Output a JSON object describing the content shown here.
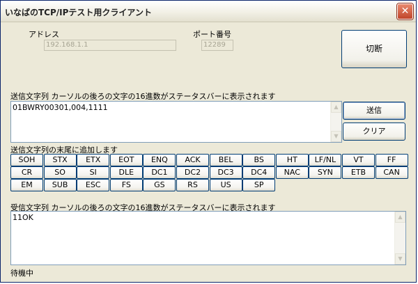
{
  "window": {
    "title": "いなばのTCP/IPテスト用クライアント",
    "close_glyph": "✕"
  },
  "connection": {
    "address_label": "アドレス",
    "address_value": "192.168.1.1",
    "port_label": "ポート番号",
    "port_value": "12289",
    "disconnect_button": "切断"
  },
  "send": {
    "label": "送信文字列 カーソルの後ろの文字の16進数がステータスバーに表示されます",
    "value": "01BWRY00301,004,1111",
    "send_button": "送信",
    "clear_button": "クリア",
    "append_label": "送信文字列の末尾に追加します"
  },
  "control_codes": {
    "row1": [
      "SOH",
      "STX",
      "ETX",
      "EOT",
      "ENQ",
      "ACK",
      "BEL",
      "BS",
      "HT",
      "LF/NL",
      "VT",
      "FF"
    ],
    "row2": [
      "CR",
      "SO",
      "SI",
      "DLE",
      "DC1",
      "DC2",
      "DC3",
      "DC4",
      "NAC",
      "SYN",
      "ETB",
      "CAN"
    ],
    "row3": [
      "EM",
      "SUB",
      "ESC",
      "FS",
      "GS",
      "RS",
      "US",
      "SP"
    ]
  },
  "receive": {
    "label": "受信文字列 カーソルの後ろの文字の16進数がステータスバーに表示されます",
    "value": "11OK"
  },
  "status": {
    "text": "待機中"
  },
  "icons": {
    "scroll_up": "▲",
    "scroll_down": "▼"
  }
}
